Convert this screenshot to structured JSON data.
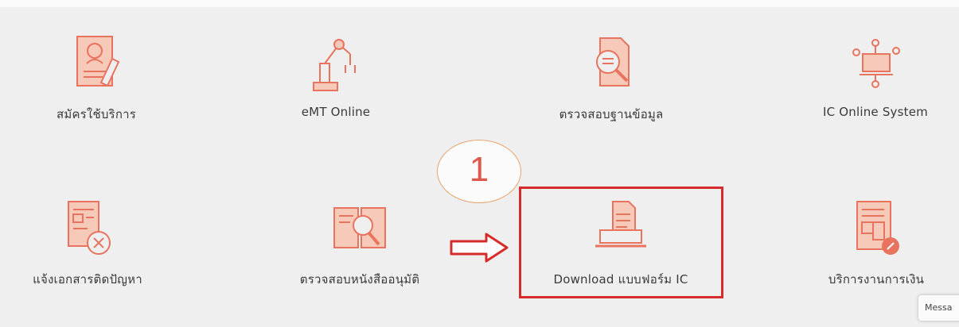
{
  "tiles": [
    {
      "label": "สมัครใช้บริการ",
      "icon": "registration-form-icon"
    },
    {
      "label": "eMT Online",
      "icon": "robot-arm-icon"
    },
    {
      "label": "ตรวจสอบฐานข้อมูล",
      "icon": "document-search-icon"
    },
    {
      "label": "IC Online System",
      "icon": "online-system-icon"
    },
    {
      "label": "แจ้งเอกสารติดปัญหา",
      "icon": "document-problem-icon"
    },
    {
      "label": "ตรวจสอบหนังสืออนุมัติ",
      "icon": "book-search-icon"
    },
    {
      "label": "Download แบบฟอร์ม IC",
      "icon": "download-form-icon"
    },
    {
      "label": "บริการงานการเงิน",
      "icon": "finance-document-icon"
    }
  ],
  "annotation": {
    "step_number": "1"
  },
  "message_tab": {
    "label": "Messa"
  },
  "colors": {
    "icon": "#e8735f",
    "highlight": "#d52b2b",
    "callout_border": "#e9a36a"
  }
}
